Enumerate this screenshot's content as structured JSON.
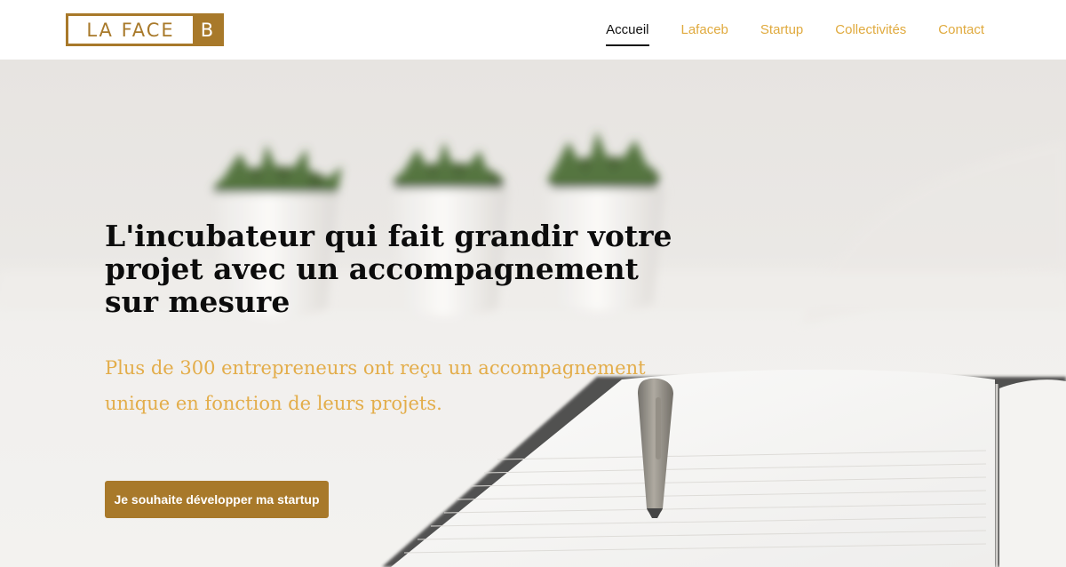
{
  "header": {
    "logo": {
      "text": "LA FACE",
      "letter": "B"
    },
    "nav": [
      {
        "label": "Accueil",
        "active": true
      },
      {
        "label": "Lafaceb",
        "active": false
      },
      {
        "label": "Startup",
        "active": false
      },
      {
        "label": "Collectivités",
        "active": false
      },
      {
        "label": "Contact",
        "active": false
      }
    ]
  },
  "hero": {
    "title": "L'incubateur qui fait grandir votre projet avec un accompagnement sur mesure",
    "subtitle": "Plus de 300 entrepreneurs ont reçu un accompagnement unique en fonction de leurs projets.",
    "cta_label": "Je souhaite développer ma startup",
    "background_image": "plants-notebook-pen-photo"
  },
  "colors": {
    "brand": "#a8792a",
    "nav_link": "#e0aa3e",
    "nav_active": "#111111",
    "subtitle": "#e3ad4a",
    "title": "#0c0c0c"
  }
}
